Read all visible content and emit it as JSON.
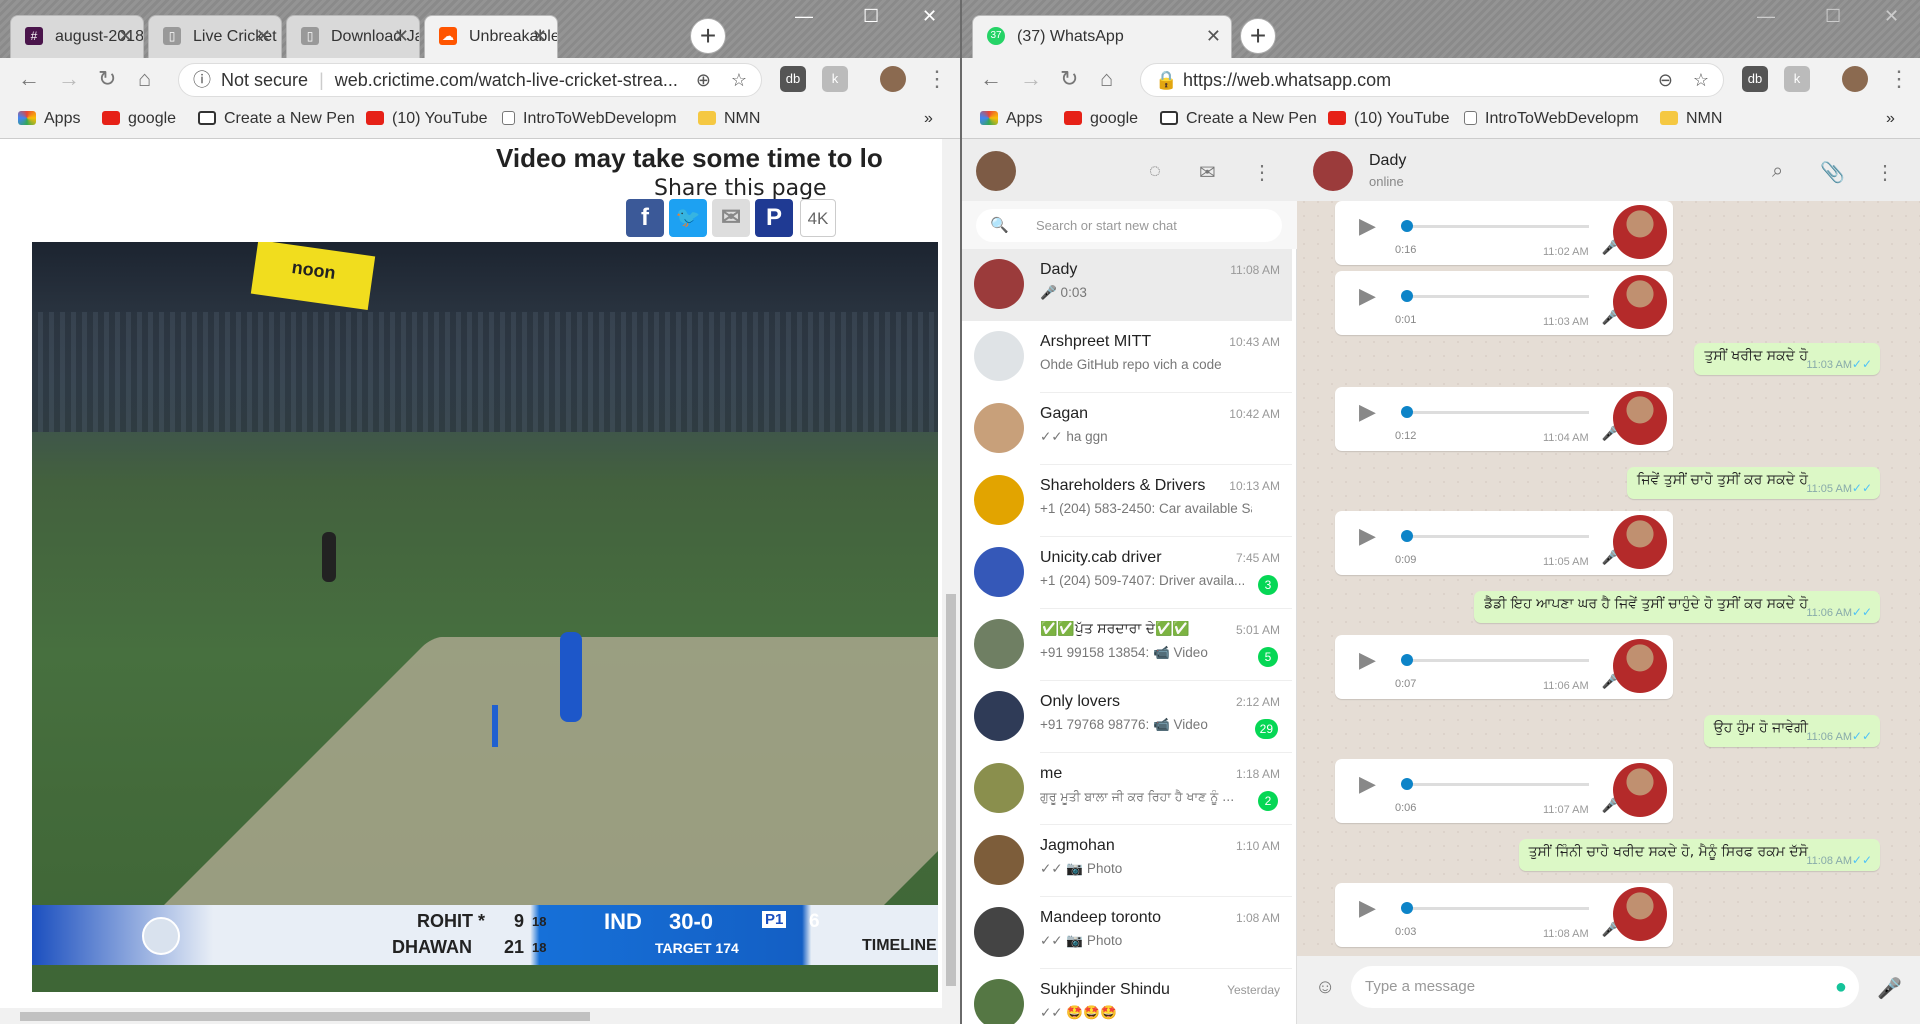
{
  "left_window": {
    "tabs": [
      {
        "title": "august-2018",
        "icon": "slack-icon",
        "color": "#4a154b"
      },
      {
        "title": "Live Cricket S",
        "icon": "page-icon",
        "color": "#777777"
      },
      {
        "title": "Download Ja",
        "icon": "page-icon",
        "color": "#777777"
      },
      {
        "title": "Unbreakable",
        "icon": "soundcloud-icon",
        "color": "#ff5500"
      }
    ],
    "omnibox": {
      "security": "Not secure",
      "url": "web.crictime.com/watch-live-cricket-strea..."
    },
    "bookmarks": [
      "Apps",
      "google",
      "Create a New Pen",
      "(10) YouTube",
      "IntroToWebDevelopm",
      "NMN"
    ],
    "bookmarks_more": "»",
    "page": {
      "heading": "Video may take some time to lo",
      "share_label": "Share this page",
      "share_4k": "4K",
      "scoreboard": {
        "batter1": "ROHIT *",
        "batter1_runs": "9",
        "batter1_balls": "18",
        "batter2": "DHAWAN",
        "batter2_runs": "21",
        "batter2_balls": "18",
        "team": "IND",
        "score": "30-0",
        "pp": "P1",
        "overs": "6",
        "target": "TARGET 174",
        "timeline": "TIMELINE"
      },
      "ad_text": "noon"
    }
  },
  "right_window": {
    "tab": {
      "title": "(37) WhatsApp",
      "badge": "37"
    },
    "omnibox": {
      "url": "https://web.whatsapp.com"
    },
    "bookmarks": [
      "Apps",
      "google",
      "Create a New Pen",
      "(10) YouTube",
      "IntroToWebDevelopm",
      "NMN"
    ],
    "bookmarks_more": "»",
    "search_placeholder": "Search or start new chat",
    "chats": [
      {
        "name": "Dady",
        "time": "11:08 AM",
        "preview": "🎤 0:03",
        "badge": "",
        "color": "#9b3b3b"
      },
      {
        "name": "Arshpreet MITT",
        "time": "10:43 AM",
        "preview": "Ohde GitHub repo vich a code",
        "badge": "",
        "color": "#dfe3e6"
      },
      {
        "name": "Gagan",
        "time": "10:42 AM",
        "preview": "✓✓ ha ggn",
        "badge": "",
        "color": "#c8a07a"
      },
      {
        "name": "Shareholders & Drivers",
        "time": "10:13 AM",
        "preview": "+1 (204) 583-2450: Car available Sa...",
        "badge": "",
        "color": "#e2a400"
      },
      {
        "name": "Unicity.cab driver",
        "time": "7:45 AM",
        "preview": "+1 (204) 509-7407: Driver availa...",
        "badge": "3",
        "color": "#3558b8"
      },
      {
        "name": "✅✅ਪੁੱਤ ਸਰਦਾਰਾ ਦੇ✅✅",
        "time": "5:01 AM",
        "preview": "+91 99158 13854: 📹 Video",
        "badge": "5",
        "color": "#6f7f63"
      },
      {
        "name": "Only lovers",
        "time": "2:12 AM",
        "preview": "+91 79768 98776: 📹 Video",
        "badge": "29",
        "color": "#2f3b57"
      },
      {
        "name": "me",
        "time": "1:18 AM",
        "preview": "ਗੁਰੂ ਮੂਤੀ ਬਾਲਾ ਜੀ ਕਰ ਰਿਹਾ ਹੈ ਖਾਣ ਨੂੰ ...",
        "badge": "2",
        "color": "#8a8f4d"
      },
      {
        "name": "Jagmohan",
        "time": "1:10 AM",
        "preview": "✓✓ 📷 Photo",
        "badge": "",
        "color": "#7d5d3a"
      },
      {
        "name": "Mandeep toronto",
        "time": "1:08 AM",
        "preview": "✓✓ 📷 Photo",
        "badge": "",
        "color": "#444444"
      },
      {
        "name": "Sukhjinder Shindu",
        "time": "Yesterday",
        "preview": "✓✓ 🤩🤩🤩",
        "badge": "",
        "color": "#557744"
      }
    ],
    "conversation": {
      "name": "Dady",
      "status": "online",
      "voice_messages": [
        {
          "duration": "0:16",
          "time": "11:02 AM"
        },
        {
          "duration": "0:01",
          "time": "11:03 AM"
        },
        {
          "duration": "0:12",
          "time": "11:04 AM"
        },
        {
          "duration": "0:09",
          "time": "11:05 AM"
        },
        {
          "duration": "0:07",
          "time": "11:06 AM"
        },
        {
          "duration": "0:06",
          "time": "11:07 AM"
        },
        {
          "duration": "0:03",
          "time": "11:08 AM"
        }
      ],
      "outgoing": [
        {
          "text": "ਤੁਸੀਂ ਖਰੀਦ ਸਕਦੇ ਹੋ",
          "time": "11:03 AM"
        },
        {
          "text": "ਜਿਵੇਂ ਤੁਸੀਂ ਚਾਹੋ ਤੁਸੀਂ ਕਰ ਸਕਦੇ ਹੋ",
          "time": "11:05 AM"
        },
        {
          "text": "ਡੈਡੀ ਇਹ ਆਪਣਾ ਘਰ ਹੈ ਜਿਵੇਂ ਤੁਸੀਂ ਚਾਹੁੰਦੇ ਹੋ ਤੁਸੀਂ ਕਰ ਸਕਦੇ ਹੋ",
          "time": "11:06 AM"
        },
        {
          "text": "ਉਹ ਹੁੰਮ ਹੋ ਜਾਵੇਗੀ",
          "time": "11:06 AM"
        },
        {
          "text": "ਤੁਸੀਂ ਜਿੰਨੀ ਚਾਹੋ ਖਰੀਦ ਸਕਦੇ ਹੋ, ਮੈਨੂੰ ਸਿਰਫ ਰਕਮ ਦੱਸੋ",
          "time": "11:08 AM"
        }
      ],
      "compose_placeholder": "Type a message"
    }
  }
}
